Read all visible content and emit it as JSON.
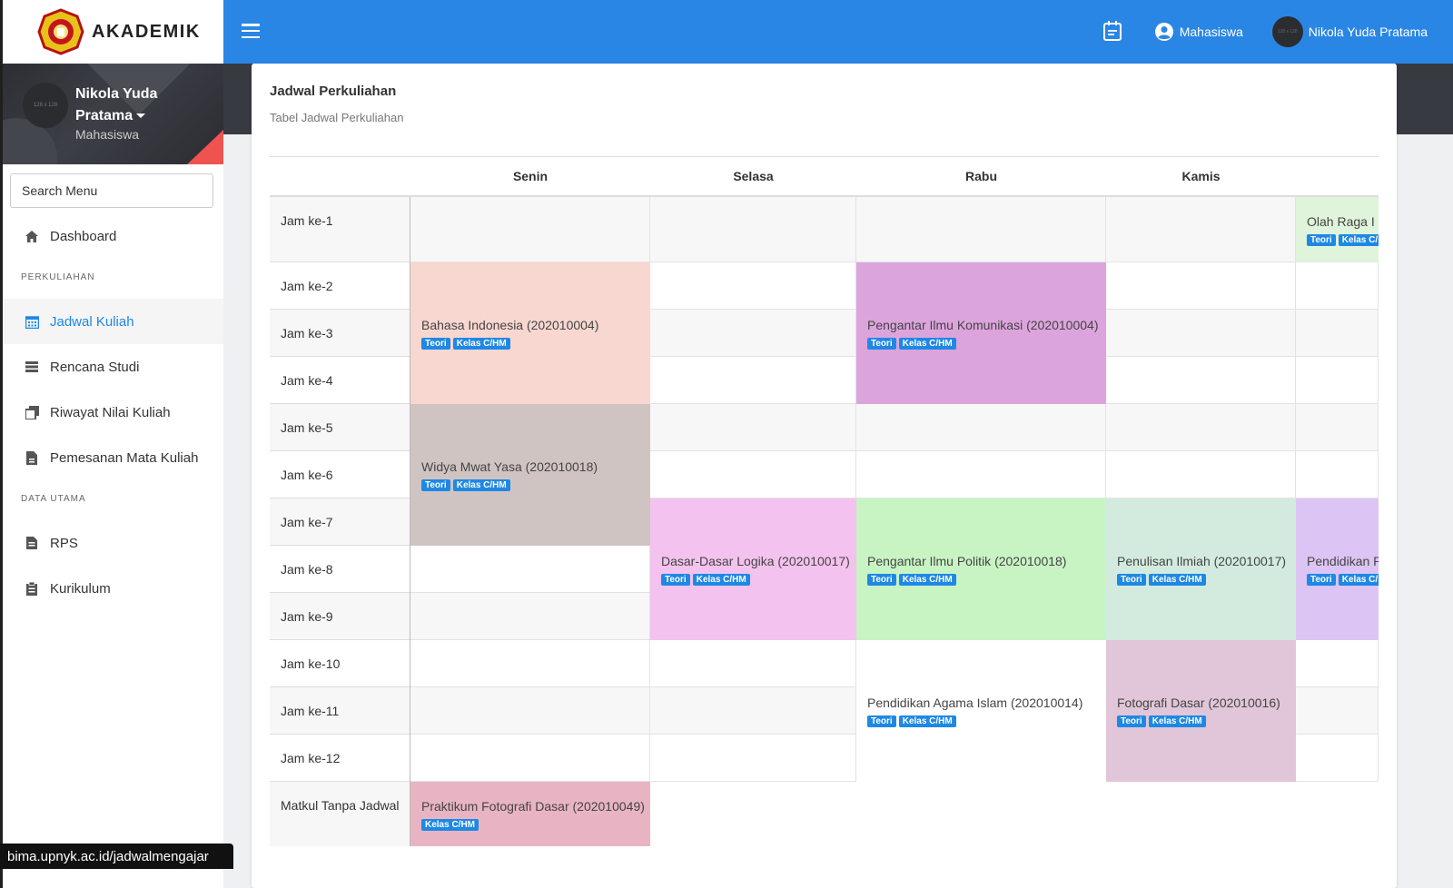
{
  "brand": {
    "name": "AKADEMIK"
  },
  "profile": {
    "name": "Nikola Yuda Pratama",
    "role": "Mahasiswa",
    "avatar_text": "128 x 128"
  },
  "search": {
    "placeholder": "Search Menu"
  },
  "menu": {
    "dashboard": "Dashboard",
    "section_perkuliahan": "PERKULIAHAN",
    "jadwal": "Jadwal Kuliah",
    "rencana": "Rencana Studi",
    "riwayat": "Riwayat Nilai Kuliah",
    "pemesanan": "Pemesanan Mata Kuliah",
    "section_data": "DATA UTAMA",
    "rps": "RPS",
    "kurikulum": "Kurikulum"
  },
  "topbar": {
    "role": "Mahasiswa",
    "user": "Nikola Yuda Pratama",
    "avatar_text": "128 x 128"
  },
  "card": {
    "title": "Jadwal Perkuliahan",
    "subtitle": "Tabel Jadwal Perkuliahan"
  },
  "days": [
    "Senin",
    "Selasa",
    "Rabu",
    "Kamis",
    ""
  ],
  "rows": [
    "Jam ke-1",
    "Jam ke-2",
    "Jam ke-3",
    "Jam ke-4",
    "Jam ke-5",
    "Jam ke-6",
    "Jam ke-7",
    "Jam ke-8",
    "Jam ke-9",
    "Jam ke-10",
    "Jam ke-11",
    "Jam ke-12",
    "Matkul Tanpa Jadwal"
  ],
  "courses": [
    {
      "name": "Bahasa Indonesia (202010004)",
      "tags": [
        "Teori",
        "Kelas C/HM"
      ],
      "color": "#f8d7d1"
    },
    {
      "name": "Pengantar Ilmu Komunikasi (202010004)",
      "tags": [
        "Teori",
        "Kelas C/HM"
      ],
      "color": "#dca4dc"
    },
    {
      "name": "Widya Mwat Yasa (202010018)",
      "tags": [
        "Teori",
        "Kelas C/HM"
      ],
      "color": "#d0c4c2"
    },
    {
      "name": "Dasar-Dasar Logika (202010017)",
      "tags": [
        "Teori",
        "Kelas C/HM"
      ],
      "color": "#f4c2ee"
    },
    {
      "name": "Pengantar Ilmu Politik (202010018)",
      "tags": [
        "Teori",
        "Kelas C/HM"
      ],
      "color": "#c8f4c4"
    },
    {
      "name": "Penulisan Ilmiah (202010017)",
      "tags": [
        "Teori",
        "Kelas C/HM"
      ],
      "color": "#d3ebdf"
    },
    {
      "name": "Pendidikan P",
      "tags": [
        "Teori",
        "Kelas C/"
      ],
      "color": "#dcc4f4"
    },
    {
      "name": "Olah Raga I (",
      "tags": [
        "Teori",
        "Kelas C/"
      ],
      "color": "#dff4da"
    },
    {
      "name": "Pendidikan Agama Islam (202010014)",
      "tags": [
        "Teori",
        "Kelas C/HM"
      ],
      "color": "#ffffff"
    },
    {
      "name": "Fotografi Dasar (202010016)",
      "tags": [
        "Teori",
        "Kelas C/HM"
      ],
      "color": "#e0c6d8"
    },
    {
      "name": "Praktikum Fotografi Dasar (202010049)",
      "tags": [
        "Kelas C/HM"
      ],
      "color": "#e8b4c4"
    }
  ],
  "statusbar": {
    "url": "bima.upnyk.ac.id/jadwalmengajar"
  },
  "colors": {
    "topbar": "#2a86e4",
    "accent": "#1e88e5",
    "tag": "#1e88e5"
  }
}
